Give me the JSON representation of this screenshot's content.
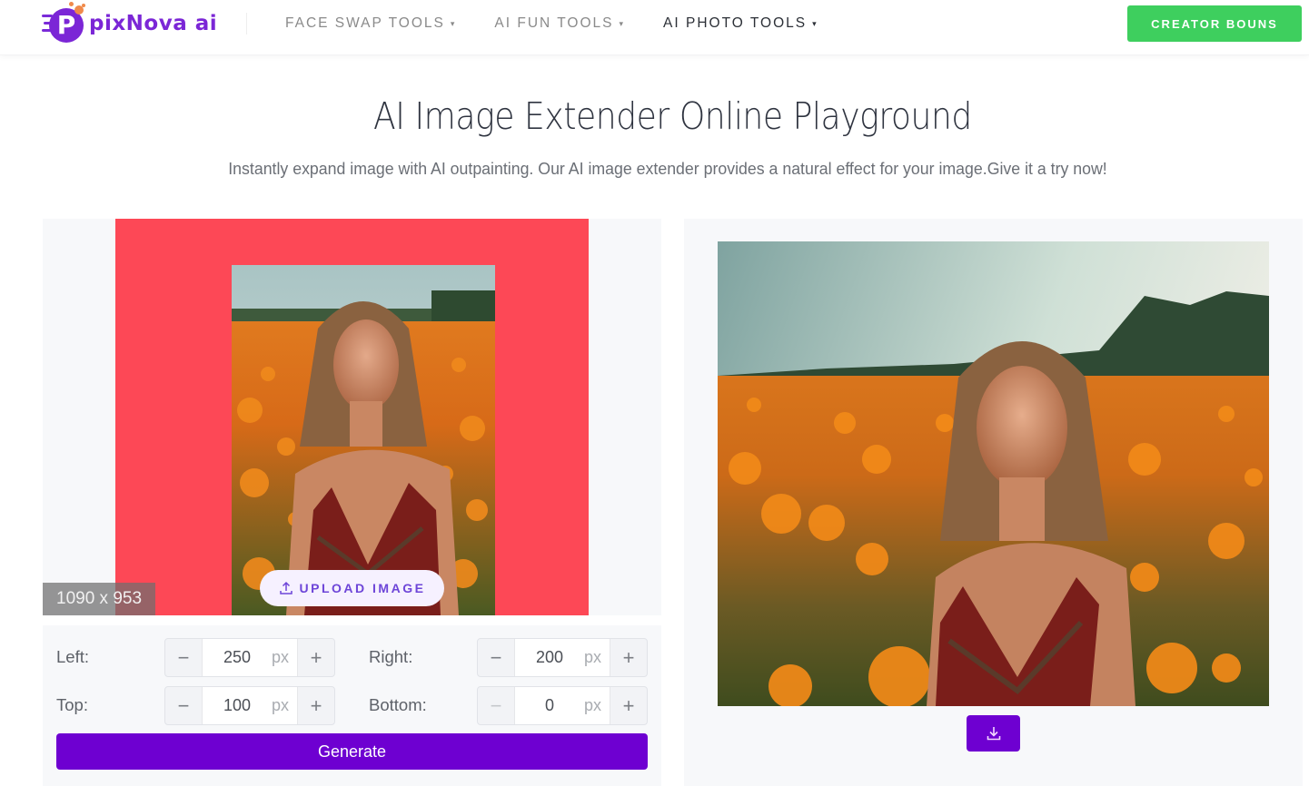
{
  "header": {
    "logo_text": "pixNova ai",
    "logo_letter": "P",
    "nav": [
      {
        "label": "FACE SWAP TOOLS",
        "active": false
      },
      {
        "label": "AI FUN TOOLS",
        "active": false
      },
      {
        "label": "AI PHOTO TOOLS",
        "active": true
      }
    ],
    "nav_caret": "▾",
    "cta_label": "CREATOR BOUNS"
  },
  "hero": {
    "title": "AI Image Extender Online Playground",
    "subtitle": "Instantly expand image with AI outpainting. Our AI image extender provides a natural effect for your image.Give it a try now!"
  },
  "editor": {
    "dimensions": "1090 x 953",
    "upload_label": "UPLOAD IMAGE",
    "upload_icon": "upload-icon",
    "extend_color": "#fd4856",
    "controls": {
      "left": {
        "label": "Left:",
        "value": "250",
        "unit": "px"
      },
      "right": {
        "label": "Right:",
        "value": "200",
        "unit": "px"
      },
      "top": {
        "label": "Top:",
        "value": "100",
        "unit": "px"
      },
      "bottom": {
        "label": "Bottom:",
        "value": "0",
        "unit": "px"
      }
    },
    "minus_symbol": "−",
    "plus_symbol": "+",
    "generate_label": "Generate"
  },
  "result": {
    "download_icon": "download-icon",
    "image_alt": "Woman standing in a field of orange flowers"
  },
  "colors": {
    "brand_purple": "#6e00d1",
    "cta_green": "#3ecf5e",
    "logo_purple": "#7b26d6"
  }
}
